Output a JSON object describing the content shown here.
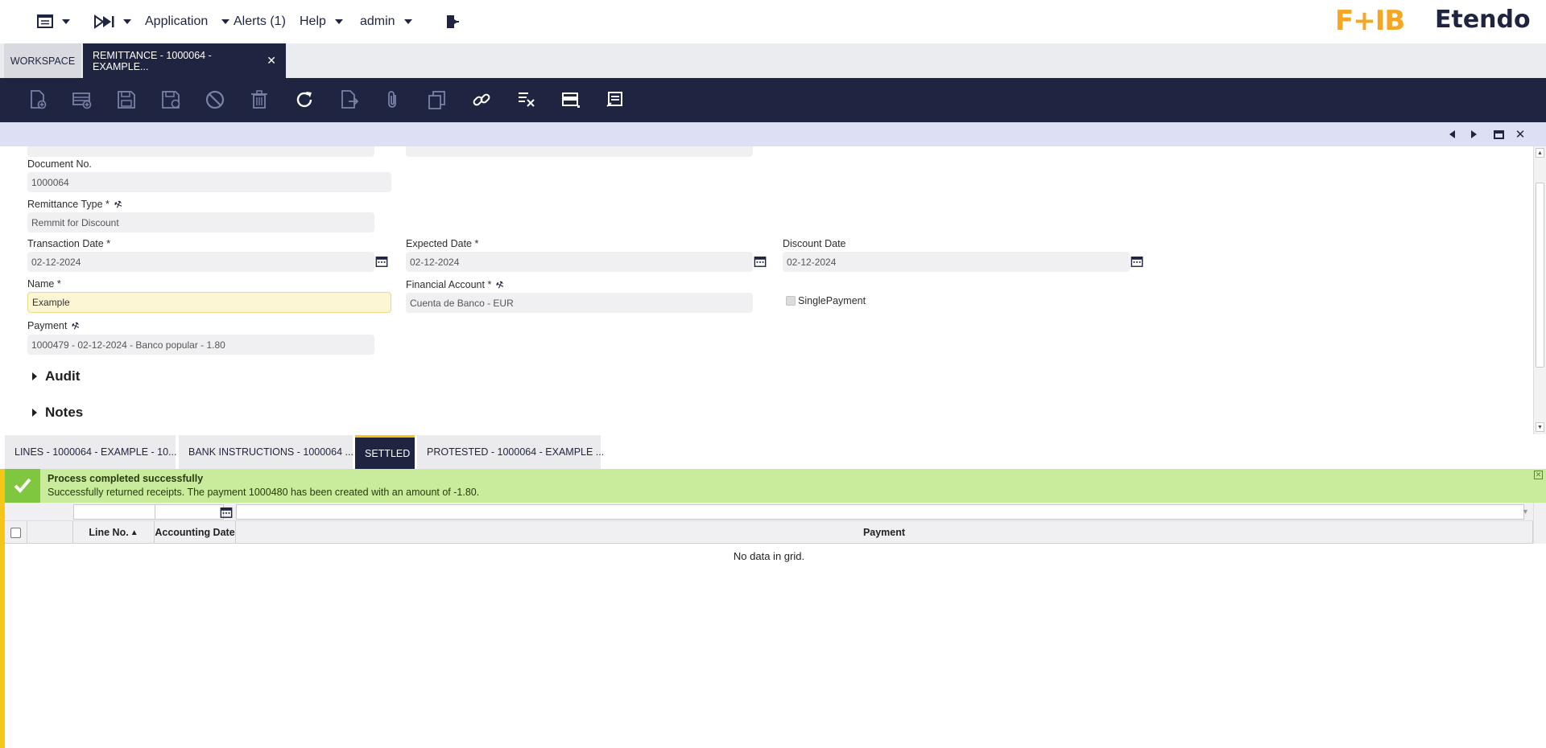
{
  "topnav": {
    "application": "Application",
    "alerts": "Alerts (1)",
    "help": "Help",
    "user": "admin"
  },
  "brand": {
    "logo_fb": "F+IB",
    "logo_etendo": "Etendo",
    "accent": "#f5a623",
    "navy": "#1f2541"
  },
  "window_tabs": {
    "workspace": "WORKSPACE",
    "active": "REMITTANCE - 1000064 - EXAMPLE..."
  },
  "form": {
    "document_no": {
      "label": "Document No.",
      "value": "1000064"
    },
    "remittance_type": {
      "label": "Remittance Type *",
      "value": "Remmit for Discount"
    },
    "transaction_date": {
      "label": "Transaction Date *",
      "value": "02-12-2024"
    },
    "expected_date": {
      "label": "Expected Date *",
      "value": "02-12-2024"
    },
    "discount_date": {
      "label": "Discount Date",
      "value": "02-12-2024"
    },
    "name": {
      "label": "Name *",
      "value": "Example"
    },
    "financial_account": {
      "label": "Financial Account *",
      "value": "Cuenta de Banco - EUR"
    },
    "single_payment": {
      "label": "SinglePayment",
      "checked": false
    },
    "payment": {
      "label": "Payment",
      "value": "1000479 - 02-12-2024 - Banco popular - 1.80"
    },
    "sections": {
      "audit": "Audit",
      "notes": "Notes"
    }
  },
  "subtabs": {
    "lines": "LINES - 1000064 - EXAMPLE - 10...",
    "bank_instructions": "BANK INSTRUCTIONS - 1000064 ...",
    "settled": "SETTLED",
    "protested": "PROTESTED - 1000064 - EXAMPLE ..."
  },
  "message": {
    "title": "Process completed successfully",
    "text": "Successfully returned receipts. The payment 1000480 has been created with an amount of -1.80.",
    "close": "✕"
  },
  "grid": {
    "columns": {
      "line_no": "Line No.",
      "accounting_date": "Accounting Date",
      "payment": "Payment"
    },
    "sort_indicator": "▲",
    "empty": "No data in grid."
  }
}
